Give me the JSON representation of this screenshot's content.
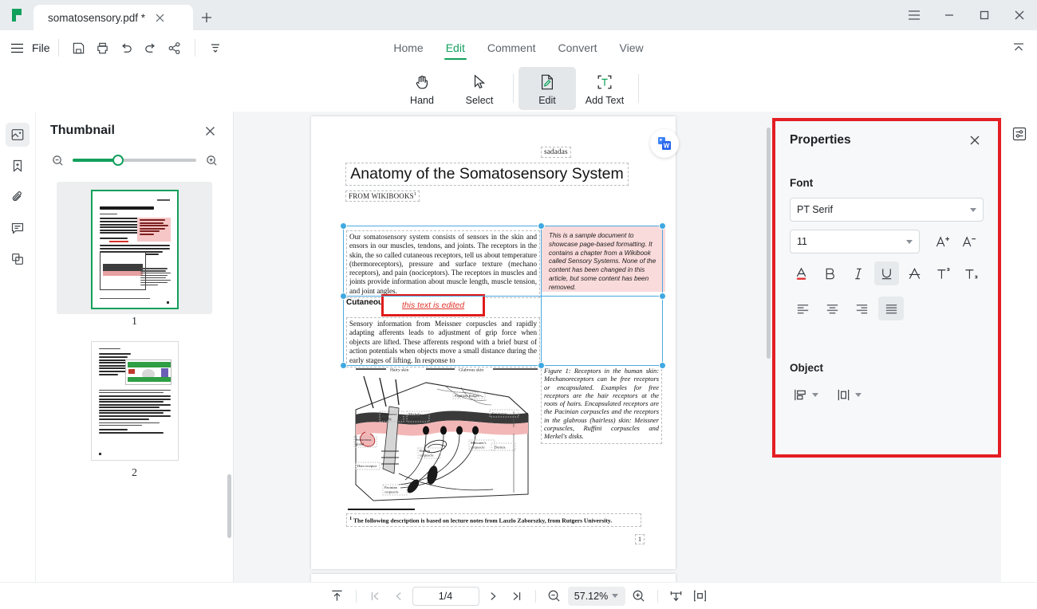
{
  "window": {
    "tab_title": "somatosensory.pdf *",
    "close_tab_icon": "close-icon",
    "new_tab_icon": "plus-icon",
    "menu_icon": "hamburger-menu-icon",
    "minimize_icon": "minimize-icon",
    "maximize_icon": "maximize-icon",
    "close_icon": "close-icon"
  },
  "menubar": {
    "file_label": "File",
    "icons": [
      "save-icon",
      "print-icon",
      "undo-icon",
      "redo-icon",
      "share-icon",
      "more-tools-icon"
    ],
    "collapse_icon": "collapse-ribbon-icon"
  },
  "ribbon": {
    "tabs": [
      {
        "label": "Home",
        "active": false
      },
      {
        "label": "Edit",
        "active": true
      },
      {
        "label": "Comment",
        "active": false
      },
      {
        "label": "Convert",
        "active": false
      },
      {
        "label": "View",
        "active": false
      }
    ],
    "tools": [
      {
        "label": "Hand",
        "icon": "hand-icon",
        "active": false
      },
      {
        "label": "Select",
        "icon": "cursor-arrow-icon",
        "active": false
      },
      {
        "label": "Edit",
        "icon": "edit-page-icon",
        "active": true
      },
      {
        "label": "Add Text",
        "icon": "add-text-icon",
        "active": false
      }
    ]
  },
  "sidebar_rail": {
    "items": [
      {
        "name": "thumbnail-icon",
        "active": true
      },
      {
        "name": "bookmark-icon",
        "active": false
      },
      {
        "name": "attachment-icon",
        "active": false
      },
      {
        "name": "comment-icon",
        "active": false
      },
      {
        "name": "pages-icon",
        "active": false
      }
    ]
  },
  "thumbnail_panel": {
    "title": "Thumbnail",
    "close_icon": "close-icon",
    "zoom_out_icon": "zoom-out-icon",
    "zoom_in_icon": "zoom-in-icon",
    "slider_value": 38,
    "pages": [
      {
        "number": "1",
        "selected": true
      },
      {
        "number": "2",
        "selected": false
      }
    ]
  },
  "document": {
    "export_badge_icon": "export-to-word-icon",
    "header_note": "sadadas",
    "title": "Anatomy of the Somatosensory System",
    "source": "FROM WIKIBOOKS",
    "source_footnote_marker": "1",
    "paragraph_1": "Our somatosensory system consists of sensors in the skin and ensors in our muscles, tendons, and joints. The receptors in the skin, the so called cutaneous receptors, tell us about temperature (thermoreceptors), pressure and surface texture (mechano receptors), and pain (nociceptors). The receptors in muscles and joints provide information about muscle length, muscle tension, and joint angles.",
    "sample_note": "This is a sample document to showcase page-based formatting. It contains a chapter from a Wikibook called Sensory Systems. None of the content has been changed in this article, but some content has been removed.",
    "subheading": "Cutaneous receptors",
    "edited_text": "this text is edited",
    "paragraph_2": "Sensory information from Meissner corpuscles and rapidly adapting afferents leads to adjustment of grip force when objects are lifted. These afferents respond with a brief burst of action potentials when objects move a small distance during the early stages of lifting. In response to",
    "figure_caption": "Figure 1: Receptors in the human skin: Mechanoreceptors can be free receptors or encapsulated. Examples for free receptors are the hair receptors at the roots of hairs. Encapsulated receptors are the Pacinian corpuscles and the receptors in the glabrous (hairless) skin: Meissner corpuscles, Ruffini corpuscles and Merkel's disks.",
    "figure_labels": {
      "hairy_skin": "Hairy skin",
      "glabrous_skin": "Glabrous skin",
      "papillary_ridges": "Papillary Ridges",
      "epidermis": "Epidermis",
      "dermis": "Dermis",
      "free_nerve": "Free nerve ending",
      "merkel": "Merkel's receptor",
      "meissner": "Meissner's corpuscle",
      "ruffini": "Ruffini corpuscle",
      "pacinian": "Pacinian corpuscle",
      "sebaceous": "Sebaceous gland",
      "hair_receptor": "Hair receptor"
    },
    "footnote": "The following description is based on lecture notes from Laszlo Zaborszky, from Rutgers University.",
    "footnote_marker": "1",
    "page_number": "1"
  },
  "properties": {
    "title": "Properties",
    "close_icon": "close-icon",
    "font_section_label": "Font",
    "font_family": "PT Serif",
    "font_size": "11",
    "increase_size_icon": "increase-font-size-icon",
    "decrease_size_icon": "decrease-font-size-icon",
    "format_buttons": [
      {
        "name": "font-color-icon",
        "label": "A",
        "selected": false
      },
      {
        "name": "bold-icon",
        "label": "B",
        "selected": false
      },
      {
        "name": "italic-icon",
        "label": "I",
        "selected": false
      },
      {
        "name": "underline-icon",
        "label": "U",
        "selected": true
      },
      {
        "name": "strikethrough-icon",
        "label": "A",
        "selected": false
      },
      {
        "name": "superscript-icon",
        "label": "T",
        "selected": false
      },
      {
        "name": "subscript-icon",
        "label": "T",
        "selected": false
      }
    ],
    "align_buttons": [
      {
        "name": "align-left-icon",
        "selected": false
      },
      {
        "name": "align-center-icon",
        "selected": false
      },
      {
        "name": "align-right-icon",
        "selected": false
      },
      {
        "name": "align-justify-icon",
        "selected": true
      }
    ],
    "object_section_label": "Object",
    "object_buttons": [
      {
        "name": "align-objects-icon"
      },
      {
        "name": "distribute-objects-icon"
      }
    ],
    "highlight_color": "#e31e24"
  },
  "right_rail": {
    "properties_panel_icon": "properties-panel-icon"
  },
  "statusbar": {
    "scroll_top_icon": "scroll-to-top-icon",
    "first_page_icon": "first-page-icon",
    "prev_page_icon": "previous-page-icon",
    "page_indicator": "1/4",
    "next_page_icon": "next-page-icon",
    "last_page_icon": "last-page-icon",
    "zoom_out_icon": "zoom-out-icon",
    "zoom_level": "57.12%",
    "zoom_in_icon": "zoom-in-icon",
    "fit_width_icon": "fit-width-icon",
    "fit_page_icon": "fit-page-icon"
  },
  "theme": {
    "accent": "#12a05c",
    "highlight_red": "#e31e24",
    "titlebar_bg": "#e9ecef",
    "workspace_bg": "#f4f5f6"
  }
}
